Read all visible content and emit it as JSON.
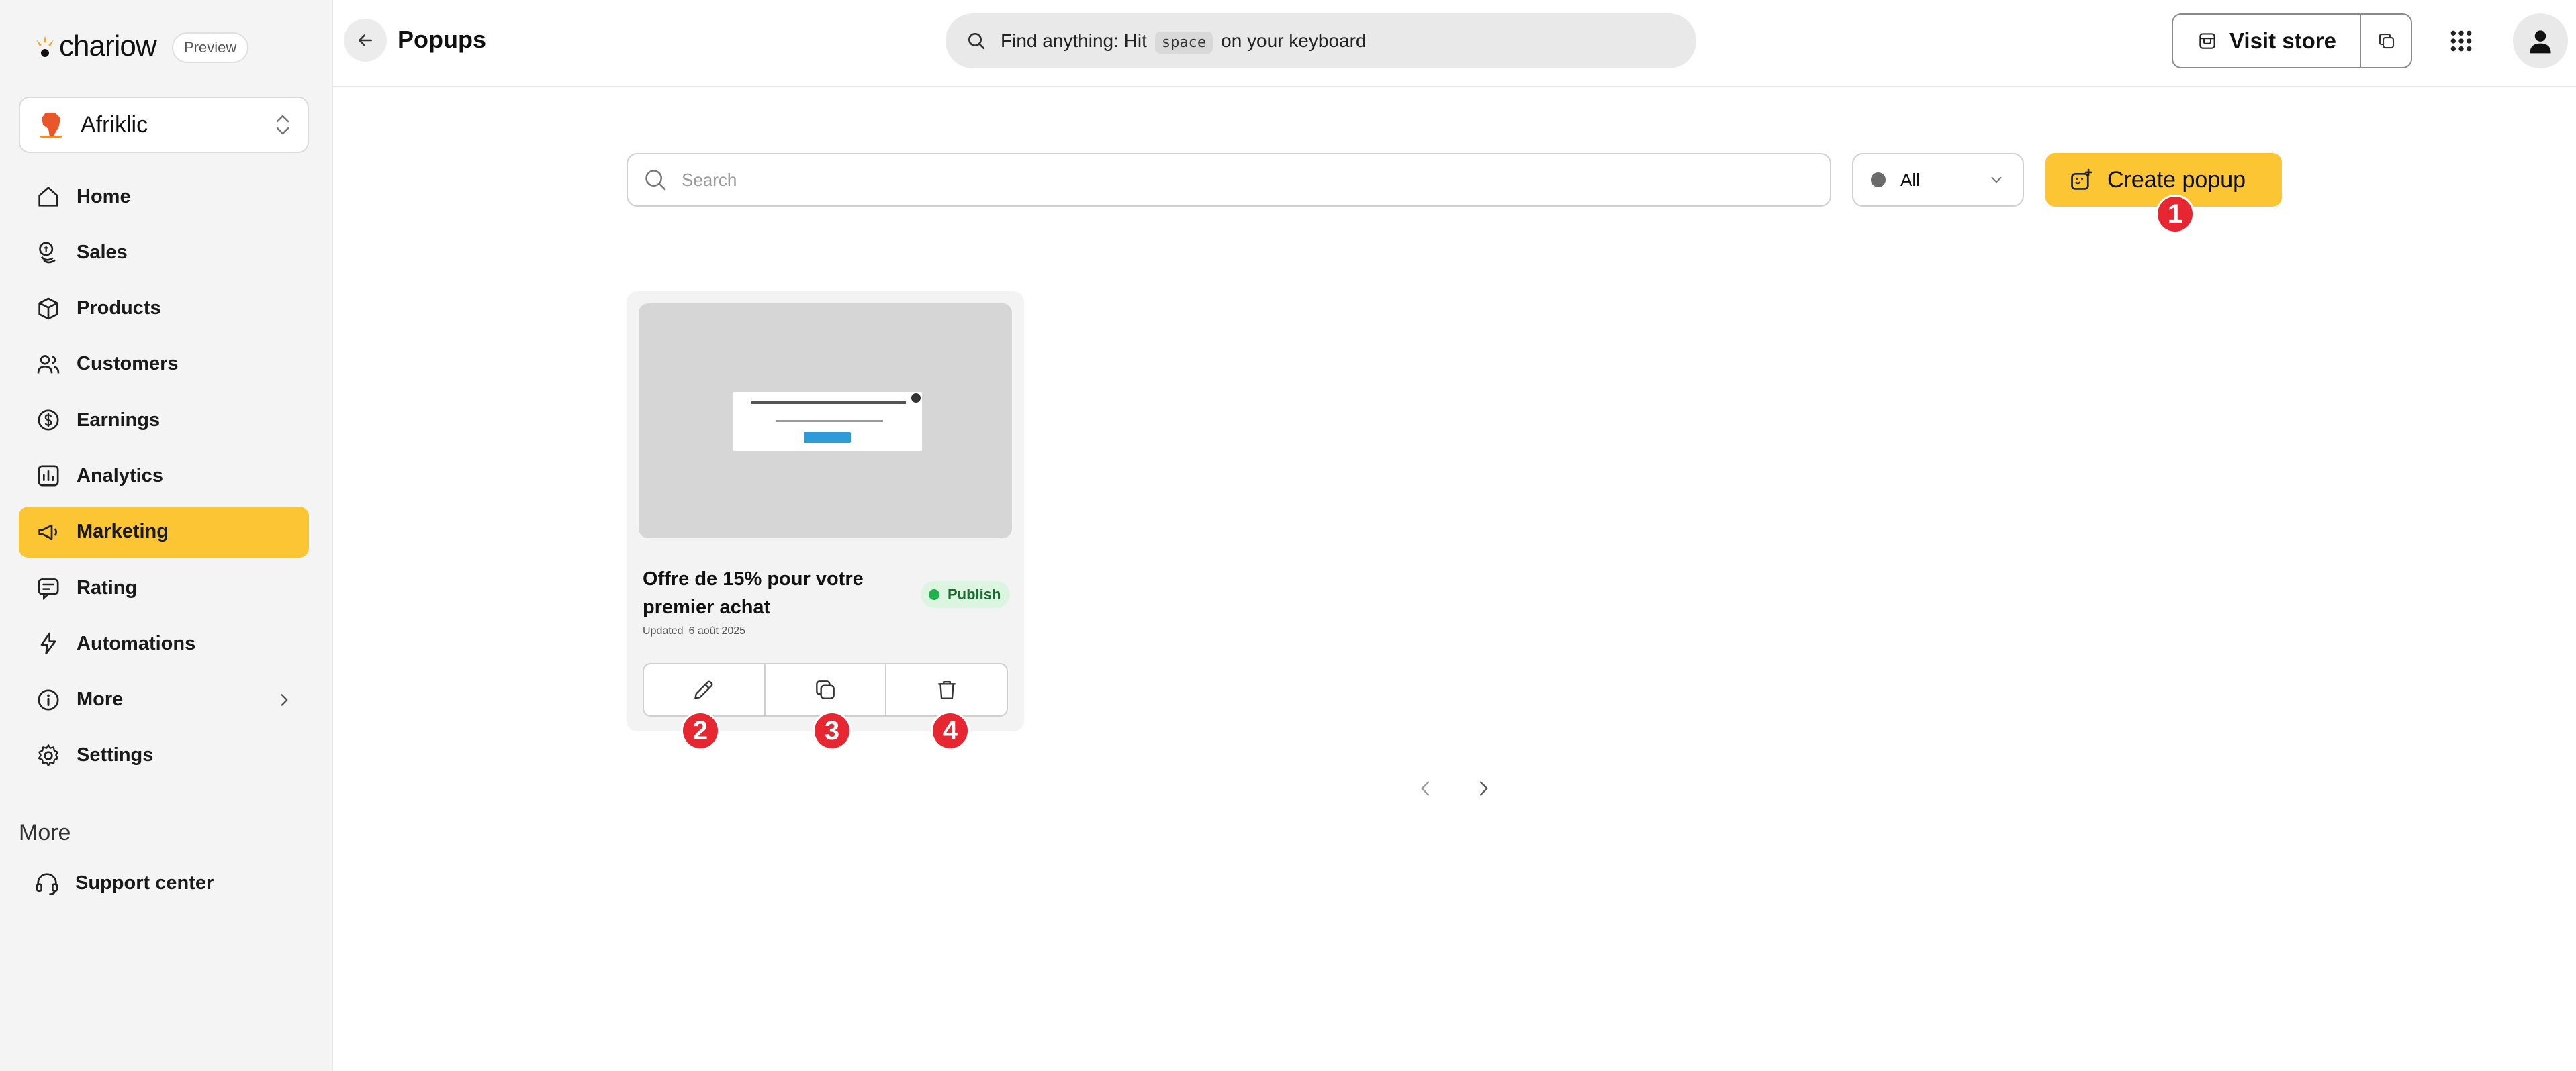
{
  "app": {
    "logo_text": "chariow",
    "preview_badge": "Preview"
  },
  "store": {
    "name": "Afriklic"
  },
  "sidebar": {
    "items": [
      {
        "label": "Home",
        "icon": "home-icon",
        "active": false
      },
      {
        "label": "Sales",
        "icon": "coins-icon",
        "active": false
      },
      {
        "label": "Products",
        "icon": "box-icon",
        "active": false
      },
      {
        "label": "Customers",
        "icon": "users-icon",
        "active": false
      },
      {
        "label": "Earnings",
        "icon": "dollar-icon",
        "active": false
      },
      {
        "label": "Analytics",
        "icon": "chart-icon",
        "active": false
      },
      {
        "label": "Marketing",
        "icon": "megaphone-icon",
        "active": true
      },
      {
        "label": "Rating",
        "icon": "rating-icon",
        "active": false
      },
      {
        "label": "Automations",
        "icon": "bolt-icon",
        "active": false
      },
      {
        "label": "More",
        "icon": "info-icon",
        "active": false
      },
      {
        "label": "Settings",
        "icon": "gear-icon",
        "active": false
      }
    ],
    "more_heading": "More",
    "support_label": "Support center"
  },
  "header": {
    "title": "Popups",
    "search_prefix": "Find anything: Hit",
    "search_key": "space",
    "search_suffix": "on your keyboard",
    "visit_store_label": "Visit store"
  },
  "toolbar": {
    "search_placeholder": "Search",
    "filter_value": "All",
    "create_label": "Create popup"
  },
  "popups": [
    {
      "title": "Offre de 15% pour votre premier achat",
      "status": "Publish",
      "updated_label": "Updated",
      "updated_date": "6 août 2025"
    }
  ],
  "markers": [
    "1",
    "2",
    "3",
    "4"
  ],
  "colors": {
    "accent": "#fbc534",
    "marker": "#e62631",
    "status_published": "#1fb14a",
    "sidebar_bg": "#f4f4f4"
  }
}
